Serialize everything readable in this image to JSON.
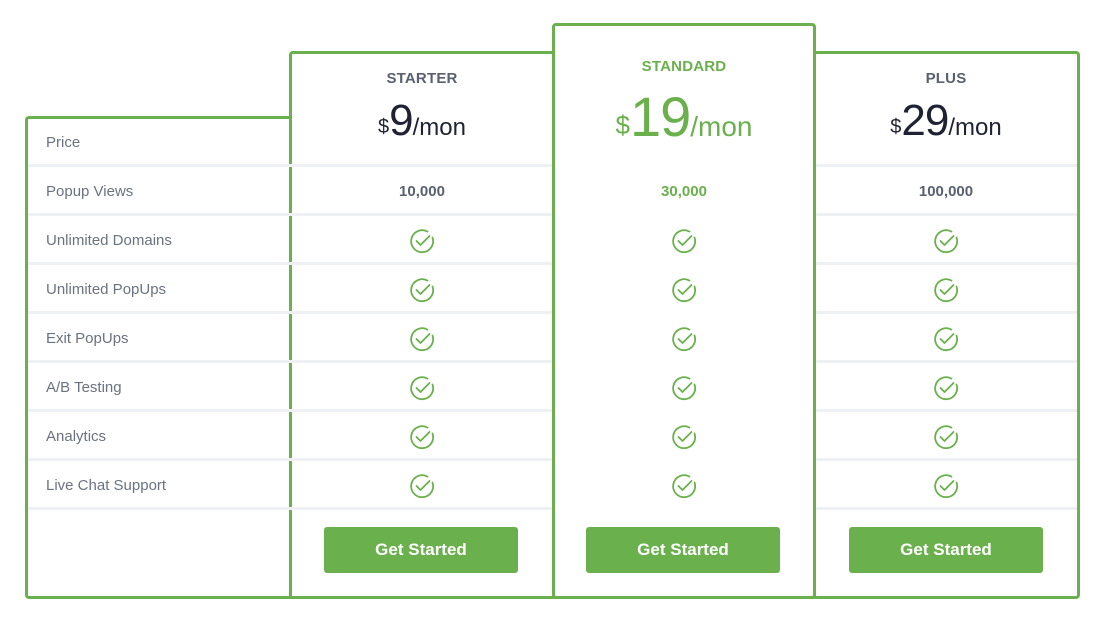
{
  "theme": {
    "accent": "#6ab04c",
    "text_dark": "#1f2233",
    "text_muted": "#6b7280",
    "divider": "#eef0f4"
  },
  "features": [
    "Price",
    "Popup Views",
    "Unlimited Domains",
    "Unlimited PopUps",
    "Exit PopUps",
    "A/B Testing",
    "Analytics",
    "Live Chat Support"
  ],
  "plans": [
    {
      "name": "STARTER",
      "currency": "$",
      "amount": "9",
      "period": "/mon",
      "popup_views": "10,000",
      "featured": false,
      "included": {
        "unlimited_domains": true,
        "unlimited_popups": true,
        "exit_popups": true,
        "ab_testing": true,
        "analytics": true,
        "live_chat_support": true
      },
      "cta": "Get Started"
    },
    {
      "name": "STANDARD",
      "currency": "$",
      "amount": "19",
      "period": "/mon",
      "popup_views": "30,000",
      "featured": true,
      "included": {
        "unlimited_domains": true,
        "unlimited_popups": true,
        "exit_popups": true,
        "ab_testing": true,
        "analytics": true,
        "live_chat_support": true
      },
      "cta": "Get Started"
    },
    {
      "name": "PLUS",
      "currency": "$",
      "amount": "29",
      "period": "/mon",
      "popup_views": "100,000",
      "featured": false,
      "included": {
        "unlimited_domains": true,
        "unlimited_popups": true,
        "exit_popups": true,
        "ab_testing": true,
        "analytics": true,
        "live_chat_support": true
      },
      "cta": "Get Started"
    }
  ],
  "icons": {
    "included": "check-circle-icon"
  }
}
